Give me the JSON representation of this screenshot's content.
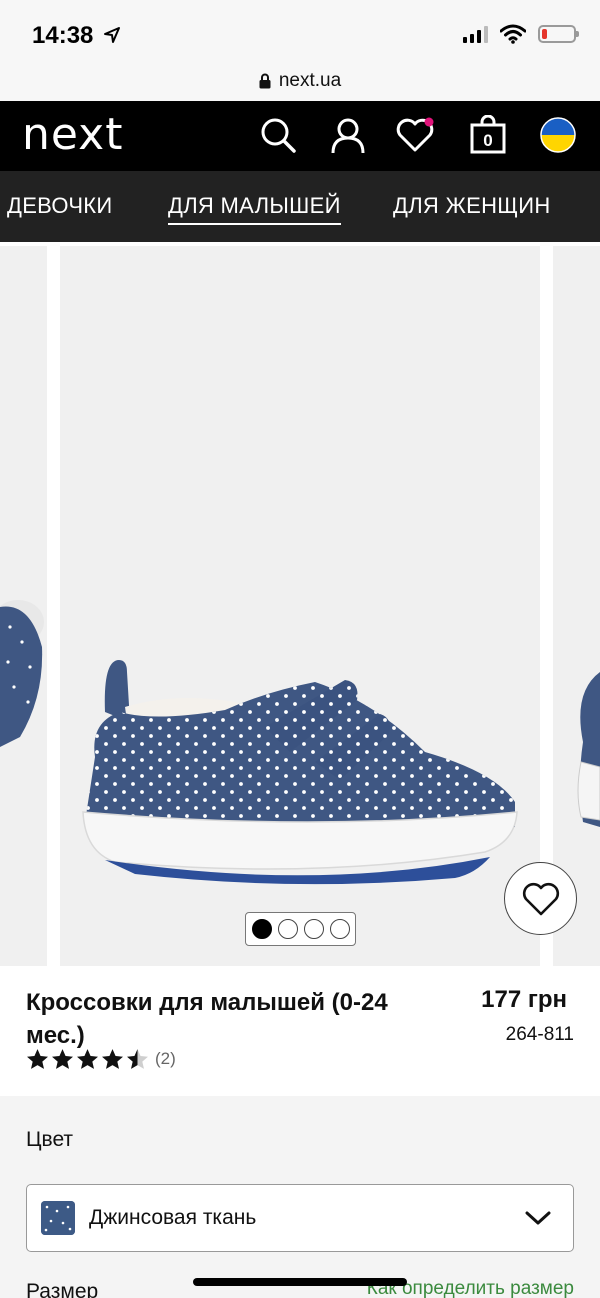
{
  "status_bar": {
    "time": "14:38",
    "battery_level": 0.15,
    "battery_color": "#e5352b"
  },
  "browser": {
    "url": "next.ua"
  },
  "header": {
    "logo": "next",
    "bag_count": "0",
    "icons": [
      "search-icon",
      "account-icon",
      "favourites-icon",
      "bag-icon",
      "ukraine-flag-icon"
    ],
    "favourites_dot_color": "#e0147a"
  },
  "categories": [
    {
      "label": "ДЕВОЧКИ"
    },
    {
      "label": "ДЛЯ МАЛЫШЕЙ",
      "active": true
    },
    {
      "label": "ДЛЯ ЖЕНЩИН"
    }
  ],
  "gallery": {
    "total_images": 4,
    "current_index": 1
  },
  "product": {
    "title": "Кроссовки для малышей (0-24 мес.)",
    "price": "177 грн",
    "sku": "264-811",
    "rating": 4.5,
    "rating_max": 5,
    "reviews_count": "(2)"
  },
  "options": {
    "color_label": "Цвет",
    "selected_color": "Джинсовая ткань",
    "size_label": "Размер",
    "size_guide_link": "Как определить размер"
  },
  "colors": {
    "accent_link": "#3b8a3e",
    "header_bg": "#000000",
    "nav_bg": "#222222"
  }
}
